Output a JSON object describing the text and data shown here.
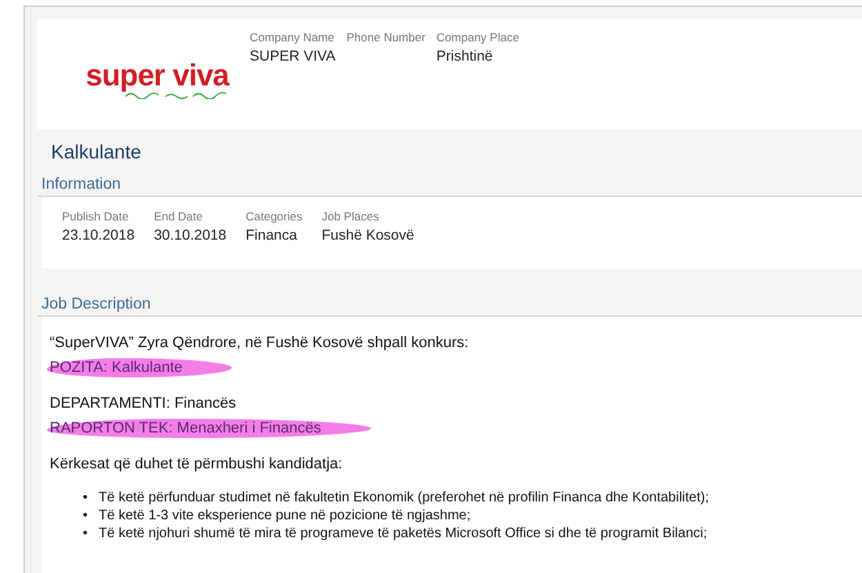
{
  "company": {
    "logo": "super viva",
    "fields": [
      {
        "label": "Company Name",
        "value": "SUPER VIVA"
      },
      {
        "label": "Phone Number"
      },
      {
        "label": "Company Place",
        "value": "Prishtinë"
      }
    ]
  },
  "job_title": "Kalkulante",
  "information": {
    "heading": "Information",
    "fields": [
      {
        "label": "Publish Date",
        "value": "23.10.2018"
      },
      {
        "label": "End Date",
        "value": "30.10.2018"
      },
      {
        "label": "Categories",
        "value": "Financa"
      },
      {
        "label": "Job Places",
        "value": "Fushë Kosovë"
      }
    ]
  },
  "job_description": {
    "heading": "Job Description",
    "blocks": [
      {
        "kind": "paragraph",
        "text": "“SuperVIVA” Zyra Qëndrore, në Fushë Kosovë shpall konkurs:",
        "highlighted": false
      },
      {
        "kind": "paragraph",
        "text": "POZITA: Kalkulante",
        "highlighted": true
      },
      {
        "kind": "line",
        "text": "DEPARTAMENTI: Financës",
        "highlighted": false
      },
      {
        "kind": "paragraph",
        "text": "RAPORTON TEK: Menaxheri i Financës",
        "highlighted": true
      },
      {
        "kind": "paragraph",
        "text": "Kërkesat që duhet të përmbushi kandidatja:",
        "highlighted": false
      },
      {
        "kind": "bullets",
        "marker": "•",
        "items": [
          "Të ketë përfunduar studimet në fakultetin Ekonomik (preferohet në profilin Financa dhe Kontabilitet);",
          "Të ketë 1-3 vite eksperience pune në pozicione të ngjashme;",
          "Të ketë njohuri shumë të mira të programeve të paketës Microsoft Office si dhe të programit Bilanci;"
        ]
      }
    ]
  }
}
